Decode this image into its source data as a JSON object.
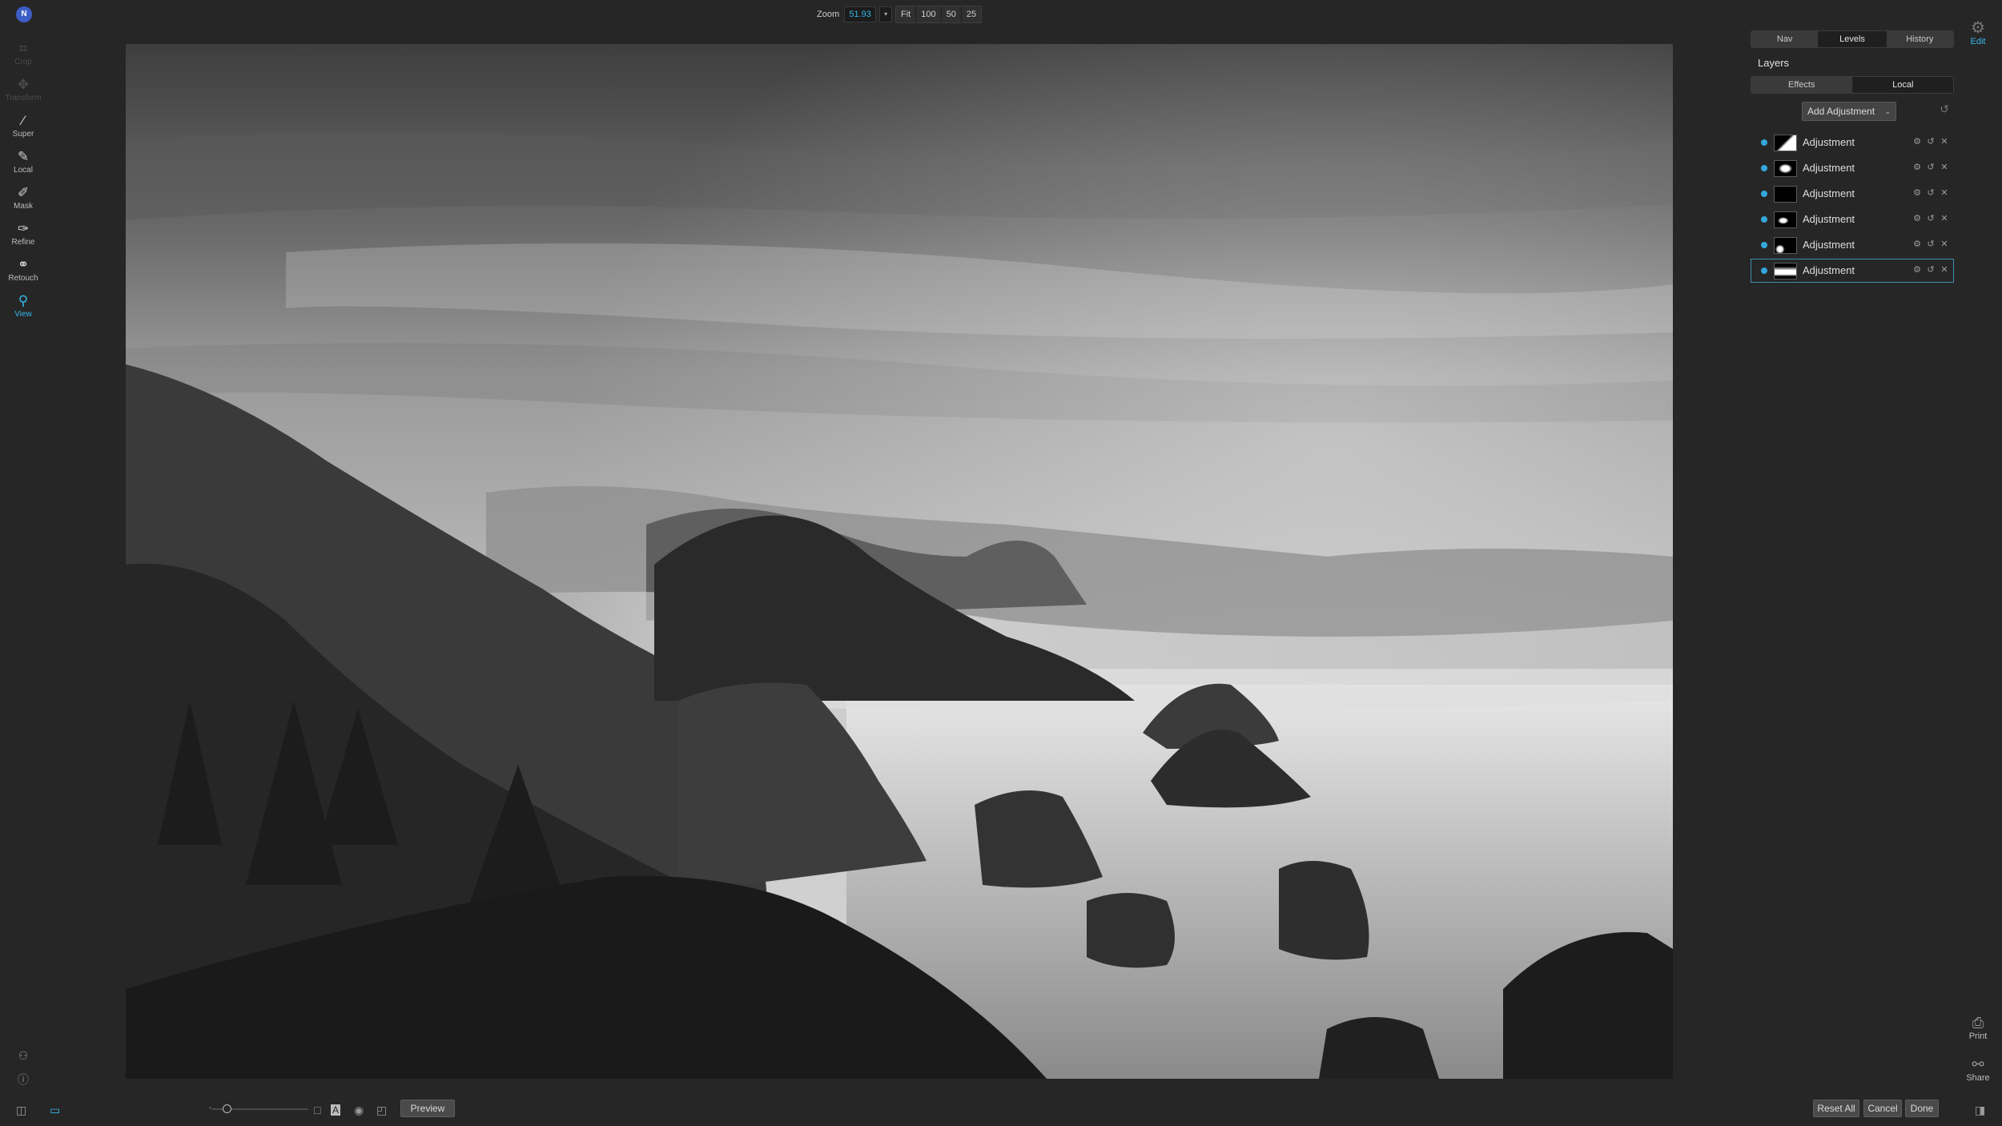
{
  "app": {
    "logo_letter": "N"
  },
  "zoom": {
    "label": "Zoom",
    "value": "51.93",
    "presets": [
      "Fit",
      "100",
      "50",
      "25"
    ]
  },
  "tools": [
    {
      "label": "Crop",
      "icon": "crop-icon",
      "state": "disabled"
    },
    {
      "label": "Transform",
      "icon": "transform-icon",
      "state": "disabled"
    },
    {
      "label": "Super",
      "icon": "super-icon",
      "state": "normal"
    },
    {
      "label": "Local",
      "icon": "local-brush-icon",
      "state": "normal"
    },
    {
      "label": "Mask",
      "icon": "mask-icon",
      "state": "normal"
    },
    {
      "label": "Refine",
      "icon": "refine-icon",
      "state": "normal"
    },
    {
      "label": "Retouch",
      "icon": "retouch-icon",
      "state": "normal"
    },
    {
      "label": "View",
      "icon": "view-icon",
      "state": "active"
    }
  ],
  "right_rail": {
    "edit_label": "Edit",
    "print_label": "Print",
    "share_label": "Share"
  },
  "panel": {
    "top_tabs": [
      "Nav",
      "Levels",
      "History"
    ],
    "active_top_tab": "Levels",
    "title": "Layers",
    "sub_tabs": [
      "Effects",
      "Local"
    ],
    "active_sub_tab": "Local",
    "add_button_label": "Add Adjustment",
    "layers": [
      {
        "name": "Adjustment",
        "visible": true,
        "selected": false
      },
      {
        "name": "Adjustment",
        "visible": true,
        "selected": false
      },
      {
        "name": "Adjustment",
        "visible": true,
        "selected": false
      },
      {
        "name": "Adjustment",
        "visible": true,
        "selected": false
      },
      {
        "name": "Adjustment",
        "visible": true,
        "selected": false
      },
      {
        "name": "Adjustment",
        "visible": true,
        "selected": true
      }
    ]
  },
  "bottom": {
    "preview_label": "Preview",
    "reset_all_label": "Reset All",
    "cancel_label": "Cancel",
    "done_label": "Done"
  },
  "colors": {
    "accent": "#35b8e8",
    "background": "#262626",
    "selected_border": "#3d8fae"
  }
}
